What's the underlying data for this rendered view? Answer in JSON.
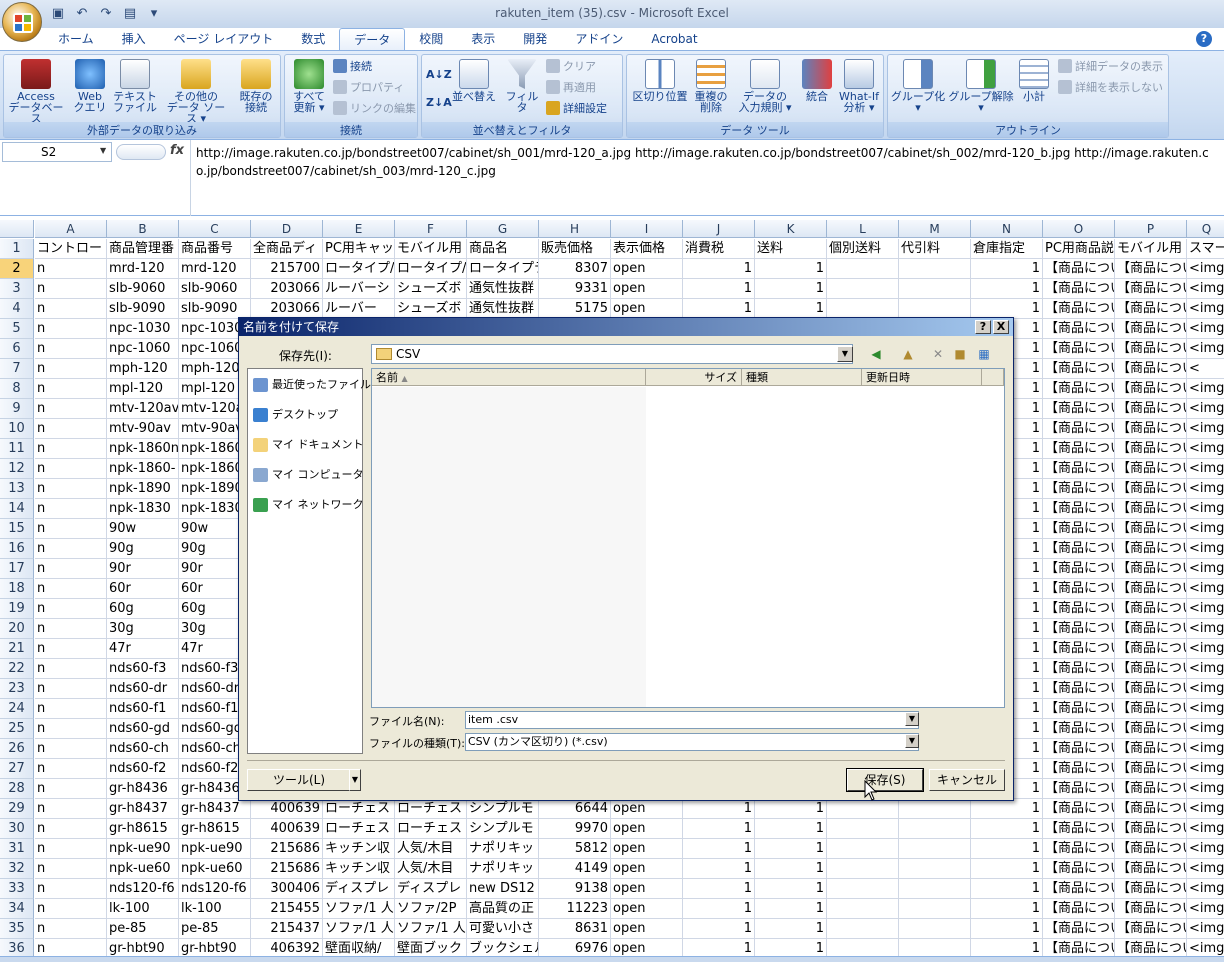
{
  "window": {
    "title": "rakuten_item (35).csv - Microsoft Excel"
  },
  "tabs": [
    "ホーム",
    "挿入",
    "ページ レイアウト",
    "数式",
    "データ",
    "校閲",
    "表示",
    "開発",
    "アドイン",
    "Acrobat"
  ],
  "active_tab": "データ",
  "ribbon": {
    "groups": [
      {
        "caption": "外部データの取り込み",
        "buttons": [
          {
            "l1": "Access",
            "l2": "データベース"
          },
          {
            "l1": "Web",
            "l2": "クエリ"
          },
          {
            "l1": "テキスト",
            "l2": "ファイル"
          },
          {
            "l1": "その他の",
            "l2": "データ ソース ▾"
          },
          {
            "l1": "既存の",
            "l2": "接続"
          }
        ]
      },
      {
        "caption": "接続",
        "buttons": [
          {
            "l1": "すべて",
            "l2": "更新 ▾"
          }
        ],
        "small": [
          "接続",
          "プロパティ",
          "リンクの編集"
        ]
      },
      {
        "caption": "並べ替えとフィルタ",
        "buttons": [
          {
            "l1": "並べ替え",
            "l2": ""
          },
          {
            "l1": "フィルタ",
            "l2": ""
          }
        ],
        "small": [
          "クリア",
          "再適用",
          "詳細設定"
        ]
      },
      {
        "caption": "データ ツール",
        "buttons": [
          {
            "l1": "区切り位置",
            "l2": ""
          },
          {
            "l1": "重複の",
            "l2": "削除"
          },
          {
            "l1": "データの",
            "l2": "入力規則 ▾"
          },
          {
            "l1": "統合",
            "l2": ""
          },
          {
            "l1": "What-If",
            "l2": "分析 ▾"
          }
        ]
      },
      {
        "caption": "アウトライン",
        "buttons": [
          {
            "l1": "グループ化",
            "l2": "▾"
          },
          {
            "l1": "グループ解除",
            "l2": "▾"
          },
          {
            "l1": "小計",
            "l2": ""
          }
        ],
        "small": [
          "詳細データの表示",
          "詳細を表示しない"
        ]
      }
    ]
  },
  "formula_bar": {
    "name_box": "S2",
    "fx": "fx",
    "content": "http://image.rakuten.co.jp/bondstreet007/cabinet/sh_001/mrd-120_a.jpg http://image.rakuten.co.jp/bondstreet007/cabinet/sh_002/mrd-120_b.jpg http://image.rakuten.co.jp/bondstreet007/cabinet/sh_003/mrd-120_c.jpg"
  },
  "columns": [
    "A",
    "B",
    "C",
    "D",
    "E",
    "F",
    "G",
    "H",
    "I",
    "J",
    "K",
    "L",
    "M",
    "N",
    "O",
    "P",
    "Q"
  ],
  "header_row": [
    "コントロー",
    "商品管理番",
    "商品番号",
    "全商品ディ",
    "PC用キャッ",
    "モバイル用",
    "商品名",
    "販売価格",
    "表示価格",
    "消費税",
    "送料",
    "個別送料",
    "代引料",
    "倉庫指定",
    "PC用商品説",
    "モバイル用",
    "スマー"
  ],
  "rows": [
    [
      "n",
      "mrd-120",
      "mrd-120",
      "215700",
      "ロータイプ/",
      "ロータイプ/",
      "ロータイプテ",
      "8307",
      "open",
      "1",
      "1",
      "",
      "",
      "1",
      "【商品につい",
      "【商品につい",
      "<img"
    ],
    [
      "n",
      "slb-9060",
      "slb-9060",
      "203066",
      "ルーバーシ",
      "シューズボ",
      "通気性抜群",
      "9331",
      "open",
      "1",
      "1",
      "",
      "",
      "1",
      "【商品につい",
      "【商品につい",
      "<img"
    ],
    [
      "n",
      "slb-9090",
      "slb-9090",
      "203066",
      "ルーバー",
      "シューズボ",
      "通気性抜群",
      "5175",
      "open",
      "1",
      "1",
      "",
      "",
      "1",
      "【商品につい",
      "【商品につい",
      "<img"
    ],
    [
      "n",
      "npc-1030",
      "npc-1030",
      "",
      "",
      "",
      "",
      "",
      "",
      "",
      "",
      "",
      "",
      "1",
      "【商品につい",
      "【商品につい",
      "<img"
    ],
    [
      "n",
      "npc-1060",
      "npc-1060",
      "",
      "",
      "",
      "",
      "",
      "",
      "",
      "",
      "",
      "",
      "1",
      "【商品につい",
      "【商品につい",
      "<img"
    ],
    [
      "n",
      "mph-120",
      "mph-120",
      "",
      "",
      "",
      "",
      "",
      "",
      "",
      "",
      "",
      "",
      "1",
      "【商品につい",
      "【商品について】",
      "<"
    ],
    [
      "n",
      "mpl-120",
      "mpl-120",
      "",
      "",
      "",
      "",
      "",
      "",
      "",
      "",
      "",
      "",
      "1",
      "【商品につい",
      "【商品につい",
      "<img"
    ],
    [
      "n",
      "mtv-120av",
      "mtv-120av",
      "",
      "",
      "",
      "",
      "",
      "",
      "",
      "",
      "",
      "",
      "1",
      "【商品につい",
      "【商品につい",
      "<img"
    ],
    [
      "n",
      "mtv-90av",
      "mtv-90av",
      "",
      "",
      "",
      "",
      "",
      "",
      "",
      "",
      "",
      "",
      "1",
      "【商品につい",
      "【商品につい",
      "<img"
    ],
    [
      "n",
      "npk-1860n",
      "npk-1860",
      "",
      "",
      "",
      "",
      "",
      "",
      "",
      "",
      "",
      "",
      "1",
      "【商品につい",
      "【商品につい",
      "<img"
    ],
    [
      "n",
      "npk-1860-",
      "npk-1860",
      "",
      "",
      "",
      "",
      "",
      "",
      "",
      "",
      "",
      "",
      "1",
      "【商品につい",
      "【商品につい",
      "<img"
    ],
    [
      "n",
      "npk-1890",
      "npk-1890",
      "",
      "",
      "",
      "",
      "",
      "",
      "",
      "",
      "",
      "",
      "1",
      "【商品につい",
      "【商品につい",
      "<img"
    ],
    [
      "n",
      "npk-1830",
      "npk-1830",
      "",
      "",
      "",
      "",
      "",
      "",
      "",
      "",
      "",
      "",
      "1",
      "【商品につい",
      "【商品につい",
      "<img"
    ],
    [
      "n",
      "90w",
      "90w",
      "",
      "",
      "",
      "",
      "",
      "",
      "",
      "",
      "",
      "",
      "1",
      "【商品につい",
      "【商品につい",
      "<img"
    ],
    [
      "n",
      "90g",
      "90g",
      "",
      "",
      "",
      "",
      "",
      "",
      "",
      "",
      "",
      "",
      "1",
      "【商品につい",
      "【商品につい",
      "<img s"
    ],
    [
      "n",
      "90r",
      "90r",
      "",
      "",
      "",
      "",
      "",
      "",
      "",
      "",
      "",
      "",
      "1",
      "【商品につい",
      "【商品につい",
      "<img s"
    ],
    [
      "n",
      "60r",
      "60r",
      "",
      "",
      "",
      "",
      "",
      "",
      "",
      "",
      "",
      "",
      "1",
      "【商品につい",
      "【商品につい",
      "<img s"
    ],
    [
      "n",
      "60g",
      "60g",
      "",
      "",
      "",
      "",
      "",
      "",
      "",
      "",
      "",
      "",
      "1",
      "【商品につい",
      "【商品につい",
      "<img s"
    ],
    [
      "n",
      "30g",
      "30g",
      "",
      "",
      "",
      "",
      "",
      "",
      "",
      "",
      "",
      "",
      "1",
      "【商品につい",
      "【商品につい",
      "<img s"
    ],
    [
      "n",
      "47r",
      "47r",
      "",
      "",
      "",
      "",
      "",
      "",
      "",
      "",
      "",
      "",
      "1",
      "【商品につい",
      "【商品につい",
      "<img"
    ],
    [
      "n",
      "nds60-f3",
      "nds60-f3",
      "",
      "",
      "",
      "",
      "",
      "",
      "",
      "",
      "",
      "",
      "1",
      "【商品につい",
      "【商品につい",
      "<img"
    ],
    [
      "n",
      "nds60-dr",
      "nds60-dr",
      "",
      "",
      "",
      "",
      "",
      "",
      "",
      "",
      "",
      "",
      "1",
      "【商品につい",
      "【商品につい",
      "<img"
    ],
    [
      "n",
      "nds60-f1",
      "nds60-f1",
      "",
      "",
      "",
      "",
      "",
      "",
      "",
      "",
      "",
      "",
      "1",
      "【商品につい",
      "【商品につい",
      "<img"
    ],
    [
      "n",
      "nds60-gd",
      "nds60-gd",
      "",
      "",
      "",
      "",
      "",
      "",
      "",
      "",
      "",
      "",
      "1",
      "【商品につい",
      "【商品につい",
      "<img"
    ],
    [
      "n",
      "nds60-ch",
      "nds60-ch",
      "",
      "",
      "",
      "",
      "",
      "",
      "",
      "",
      "",
      "",
      "1",
      "【商品につい",
      "【商品につい",
      "<img"
    ],
    [
      "n",
      "nds60-f2",
      "nds60-f2",
      "",
      "",
      "",
      "",
      "",
      "",
      "",
      "",
      "",
      "",
      "1",
      "【商品につい",
      "【商品につい",
      "<img"
    ],
    [
      "n",
      "gr-h8436",
      "gr-h8436",
      "",
      "",
      "",
      "",
      "",
      "",
      "",
      "",
      "",
      "",
      "1",
      "【商品につい",
      "【商品につい",
      "<img"
    ],
    [
      "n",
      "gr-h8437",
      "gr-h8437",
      "400639",
      "ローチェスト",
      "ローチェスト",
      "シンプルモ",
      "6644",
      "open",
      "1",
      "1",
      "",
      "",
      "1",
      "【商品につい",
      "【商品につい",
      "<img"
    ],
    [
      "n",
      "gr-h8615",
      "gr-h8615",
      "400639",
      "ローチェスト",
      "ローチェスト",
      "シンプルモ",
      "9970",
      "open",
      "1",
      "1",
      "",
      "",
      "1",
      "【商品につい",
      "【商品につい",
      "<img"
    ],
    [
      "n",
      "npk-ue90",
      "npk-ue90",
      "215686",
      "キッチン収",
      "人気/木目",
      "ナポリキッ",
      "5812",
      "open",
      "1",
      "1",
      "",
      "",
      "1",
      "【商品につい",
      "【商品につい",
      "<img"
    ],
    [
      "n",
      "npk-ue60",
      "npk-ue60",
      "215686",
      "キッチン収",
      "人気/木目",
      "ナポリキッ",
      "4149",
      "open",
      "1",
      "1",
      "",
      "",
      "1",
      "【商品につい",
      "【商品につい",
      "<img"
    ],
    [
      "n",
      "nds120-f6",
      "nds120-f6",
      "300406",
      "ディスプレ",
      "ディスプレ",
      "new DS12",
      "9138",
      "open",
      "1",
      "1",
      "",
      "",
      "1",
      "【商品につい",
      "【商品につい",
      "<img"
    ],
    [
      "n",
      "lk-100",
      "lk-100",
      "215455",
      "ソファ/1 人",
      "ソファ/2P",
      "高品質の正",
      "11223",
      "open",
      "1",
      "1",
      "",
      "",
      "1",
      "【商品につい",
      "【商品につい",
      "<img"
    ],
    [
      "n",
      "pe-85",
      "pe-85",
      "215437",
      "ソファ/1 人",
      "ソファ/1 人",
      "可愛い小さ",
      "8631",
      "open",
      "1",
      "1",
      "",
      "",
      "1",
      "【商品につい",
      "【商品につい",
      "<img"
    ],
    [
      "n",
      "gr-hbt90",
      "gr-hbt90",
      "406392",
      "壁面収納/",
      "壁面ブック",
      "ブックシェル",
      "6976",
      "open",
      "1",
      "1",
      "",
      "",
      "1",
      "【商品につい",
      "【商品につい",
      "<img"
    ]
  ],
  "dialog": {
    "title": "名前を付けて保存",
    "save_in_label": "保存先(I):",
    "save_in_value": "CSV",
    "places": [
      "最近使ったファイル",
      "デスクトップ",
      "マイ ドキュメント",
      "マイ コンピュータ",
      "マイ ネットワーク"
    ],
    "list_headers": [
      "名前",
      "サイズ",
      "種類",
      "更新日時"
    ],
    "filename_label": "ファイル名(N):",
    "filename_value": "item .csv",
    "filetype_label": "ファイルの種類(T):",
    "filetype_value": "CSV (カンマ区切り) (*.csv)",
    "tools_label": "ツール(L)",
    "save_label": "保存(S)",
    "cancel_label": "キャンセル",
    "help_btn": "?",
    "close_btn": "X"
  },
  "colors": {
    "ribbon": "#cfdff3",
    "accent": "#15428b",
    "dialog_title": "#0a246a",
    "selected_row": "#f8d37a"
  }
}
